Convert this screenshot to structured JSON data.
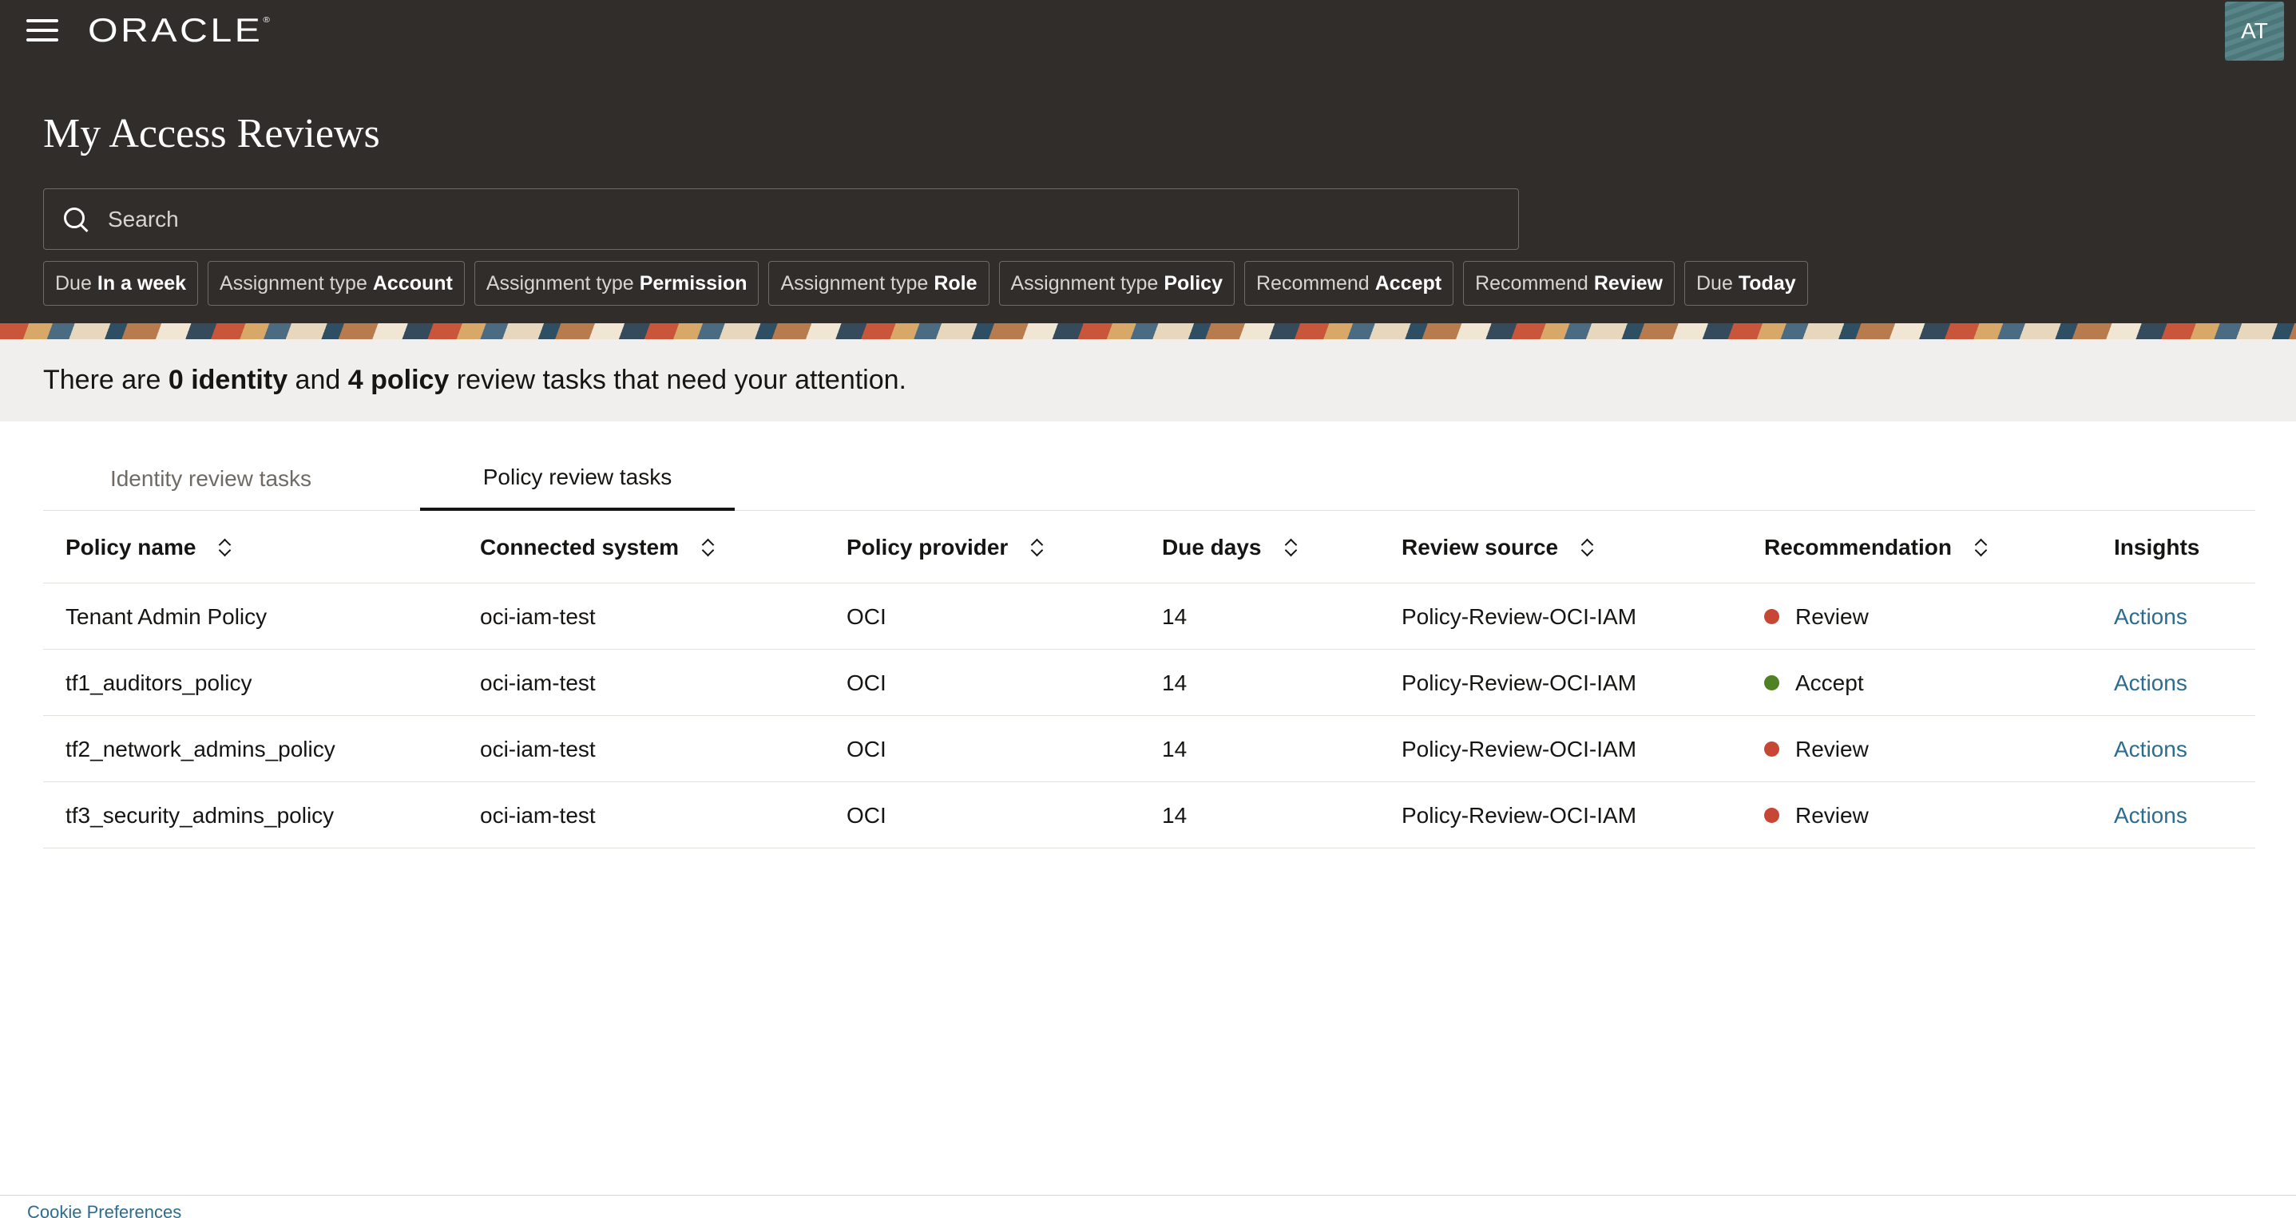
{
  "header": {
    "logo_text": "ORACLE",
    "logo_mark": "®",
    "avatar_initials": "AT",
    "title": "My Access Reviews",
    "search_placeholder": "Search",
    "filters": [
      {
        "prefix": "Due",
        "value": "In a week"
      },
      {
        "prefix": "Assignment type",
        "value": "Account"
      },
      {
        "prefix": "Assignment type",
        "value": "Permission"
      },
      {
        "prefix": "Assignment type",
        "value": "Role"
      },
      {
        "prefix": "Assignment type",
        "value": "Policy"
      },
      {
        "prefix": "Recommend",
        "value": "Accept"
      },
      {
        "prefix": "Recommend",
        "value": "Review"
      },
      {
        "prefix": "Due",
        "value": "Today"
      }
    ]
  },
  "summary": {
    "part1": "There are ",
    "identity_count": "0 identity",
    "part2": " and ",
    "policy_count": "4 policy",
    "part3": " review tasks that need your attention."
  },
  "tabs": [
    {
      "label": "Identity review tasks",
      "selected": false
    },
    {
      "label": "Policy review tasks",
      "selected": true
    }
  ],
  "table": {
    "columns": [
      "Policy name",
      "Connected system",
      "Policy provider",
      "Due days",
      "Review source",
      "Recommendation",
      "Insights"
    ],
    "rows": [
      {
        "policy_name": "Tenant Admin Policy",
        "connected_system": "oci-iam-test",
        "provider": "OCI",
        "due_days": "14",
        "review_source": "Policy-Review-OCI-IAM",
        "recommendation": "Review",
        "insights": "Actions"
      },
      {
        "policy_name": "tf1_auditors_policy",
        "connected_system": "oci-iam-test",
        "provider": "OCI",
        "due_days": "14",
        "review_source": "Policy-Review-OCI-IAM",
        "recommendation": "Accept",
        "insights": "Actions"
      },
      {
        "policy_name": "tf2_network_admins_policy",
        "connected_system": "oci-iam-test",
        "provider": "OCI",
        "due_days": "14",
        "review_source": "Policy-Review-OCI-IAM",
        "recommendation": "Review",
        "insights": "Actions"
      },
      {
        "policy_name": "tf3_security_admins_policy",
        "connected_system": "oci-iam-test",
        "provider": "OCI",
        "due_days": "14",
        "review_source": "Policy-Review-OCI-IAM",
        "recommendation": "Review",
        "insights": "Actions"
      }
    ]
  },
  "colors": {
    "review": "#c74634",
    "accept": "#508223",
    "header_bg": "#312d2a",
    "link": "#2b6c91"
  },
  "footer": {
    "cookie_link": "Cookie Preferences"
  }
}
